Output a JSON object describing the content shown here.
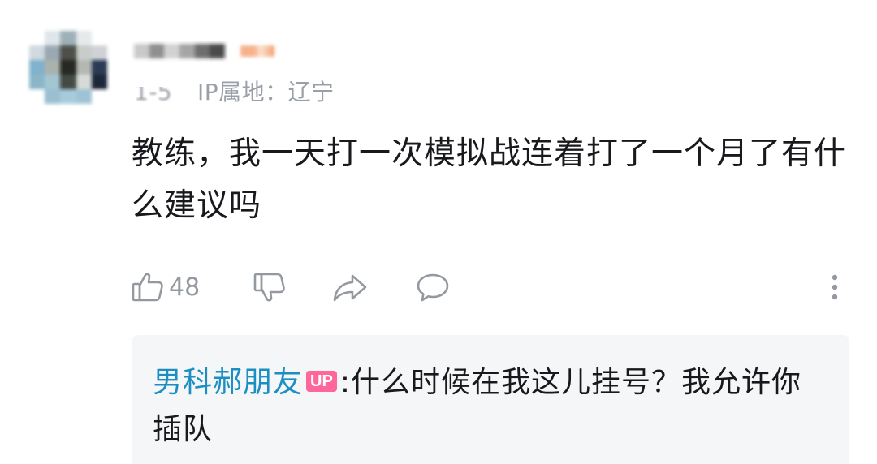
{
  "comment": {
    "ip_location": "IP属地：辽宁",
    "text": "教练，我一天打一次模拟战连着打了一个月了有什么建议吗",
    "like_count": "48"
  },
  "reply": {
    "author": "男科郝朋友",
    "author_badge": "UP",
    "separator": ":",
    "text": "什么时候在我这儿挂号？我允许你插队"
  },
  "colors": {
    "author_link": "#1b8ec2",
    "up_badge": "#ff6699",
    "icon_gray": "#9499a0",
    "reply_bg": "#f5f6f7"
  },
  "icons": {
    "like": "thumbs-up-icon",
    "dislike": "thumbs-down-icon",
    "share": "share-arrow-icon",
    "reply": "comment-bubble-icon",
    "more": "more-vertical-icon"
  }
}
